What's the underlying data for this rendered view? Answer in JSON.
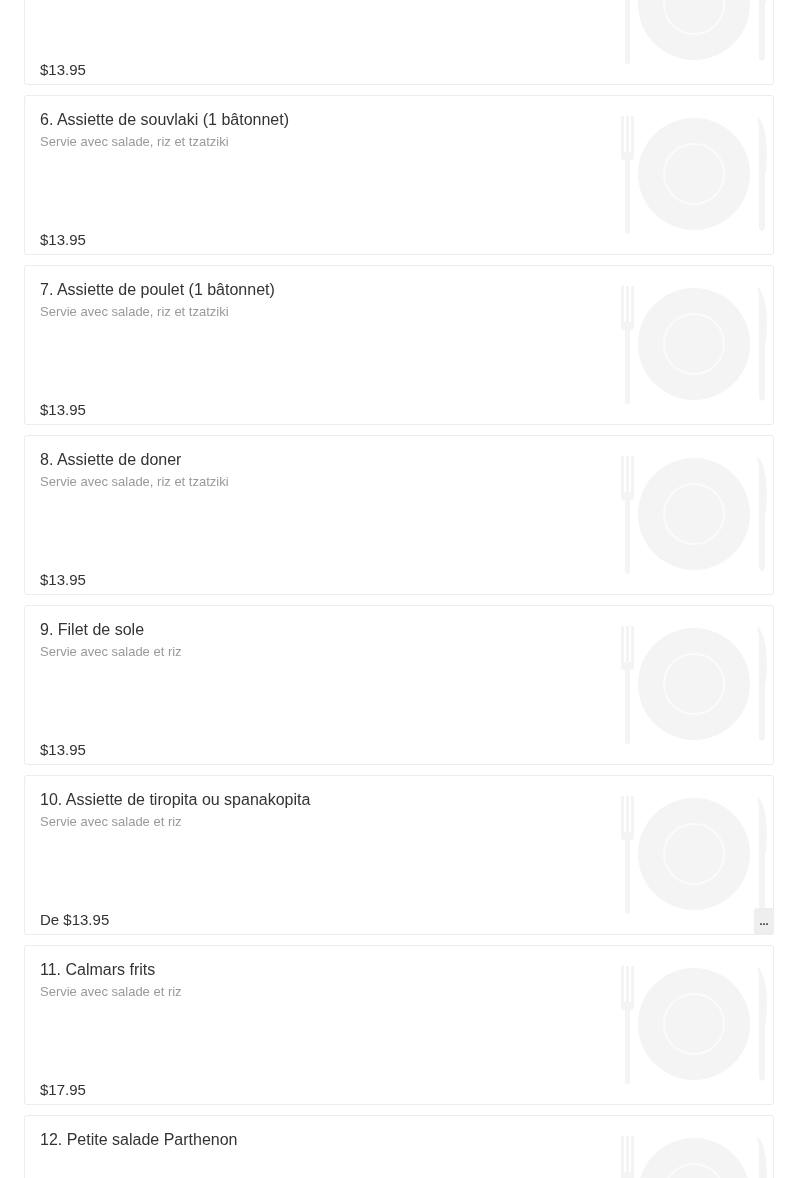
{
  "menu_items": [
    {
      "price": "$13.95"
    },
    {
      "title": "6. Assiette de souvlaki (1 bâtonnet)",
      "description": "Servie avec salade, riz et tzatziki",
      "price": "$13.95"
    },
    {
      "title": "7. Assiette de poulet (1 bâtonnet)",
      "description": "Servie avec salade, riz et tzatziki",
      "price": "$13.95"
    },
    {
      "title": "8. Assiette de doner",
      "description": "Servie avec salade, riz et tzatziki",
      "price": "$13.95"
    },
    {
      "title": "9. Filet de sole",
      "description": "Servie avec salade et riz",
      "price": "$13.95"
    },
    {
      "title": "10. Assiette de tiropita ou spanakopita",
      "description": "Servie avec salade et riz",
      "price": "De $13.95",
      "more_button": "..."
    },
    {
      "title": "11. Calmars frits",
      "description": "Servie avec salade et riz",
      "price": "$17.95"
    },
    {
      "title": "12. Petite salade Parthenon"
    }
  ]
}
